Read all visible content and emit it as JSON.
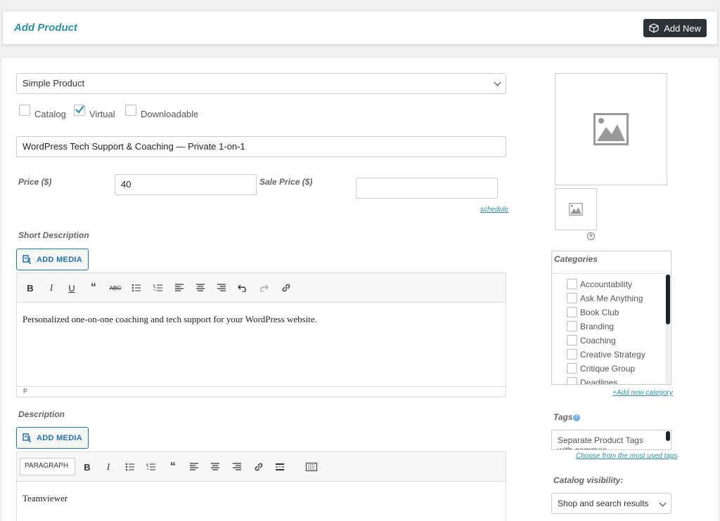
{
  "header": {
    "title": "Add Product",
    "add_new_label": "Add New"
  },
  "product_type": {
    "selected": "Simple Product"
  },
  "options": {
    "catalog": "Catalog",
    "virtual": "Virtual",
    "downloadable": "Downloadable",
    "virtual_checked": true
  },
  "product_name": "WordPress Tech Support & Coaching — Private 1-on-1",
  "price": {
    "label": "Price ($)",
    "value": "40",
    "sale_label": "Sale Price ($)",
    "sale_value": "",
    "schedule_link": "schedule"
  },
  "short_description": {
    "label": "Short Description",
    "add_media": "ADD MEDIA",
    "content": "Personalized one-on-one coaching and tech support for your WordPress website.",
    "status": "P"
  },
  "description": {
    "label": "Description",
    "add_media": "ADD MEDIA",
    "format_select": "PARAGRAPH",
    "content": "Teamviewer"
  },
  "categories": {
    "title": "Categories",
    "items": [
      "Accountability",
      "Ask Me Anything",
      "Book Club",
      "Branding",
      "Coaching",
      "Creative Strategy",
      "Critique Group",
      "Deadlines"
    ],
    "add_link": "+Add new category"
  },
  "tags": {
    "label": "Tags",
    "placeholder": "Separate Product Tags with commas",
    "choose_link": "Choose from the most used tags"
  },
  "catalog_visibility": {
    "label": "Catalog visibility:",
    "selected": "Shop and search results"
  },
  "colors": {
    "accent": "#2e8fa3",
    "link_blue": "#2271b1",
    "dark": "#2c3338"
  }
}
